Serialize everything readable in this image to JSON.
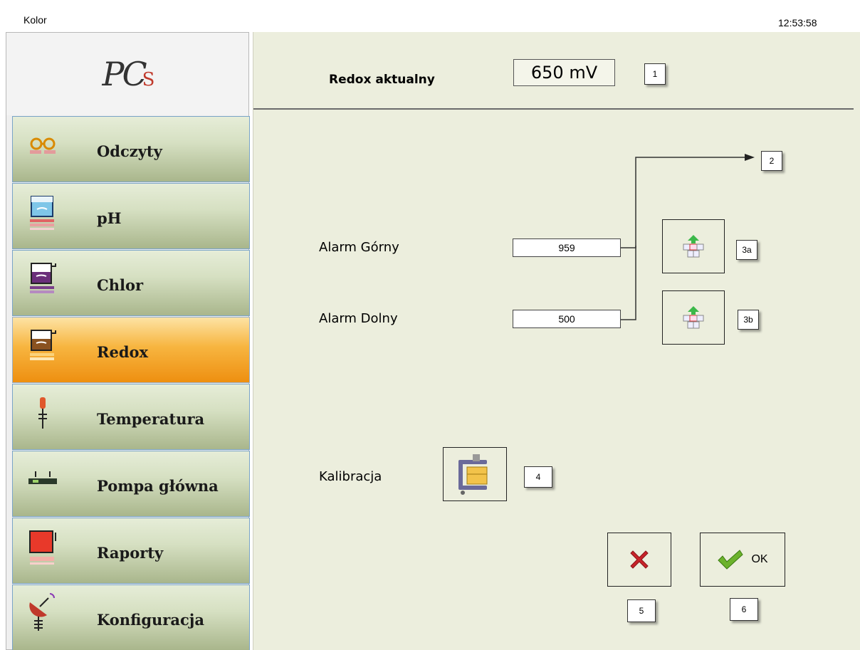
{
  "titlebar": {
    "app_title": "Kolor",
    "clock": "12:53:58"
  },
  "sidebar": {
    "logo_text": "PC",
    "logo_s": "S",
    "items": [
      {
        "label": "Odczyty",
        "icon": "glasses-icon"
      },
      {
        "label": "pH",
        "icon": "beaker-blue-icon"
      },
      {
        "label": "Chlor",
        "icon": "beaker-purple-icon"
      },
      {
        "label": "Redox",
        "icon": "beaker-orange-icon",
        "active": true
      },
      {
        "label": "Temperatura",
        "icon": "thermometer-icon"
      },
      {
        "label": "Pompa główna",
        "icon": "pump-icon"
      },
      {
        "label": "Raporty",
        "icon": "report-icon"
      },
      {
        "label": "Konfiguracja",
        "icon": "satellite-dish-icon"
      }
    ]
  },
  "main": {
    "redox_label": "Redox aktualny",
    "redox_value": "650 mV",
    "alarm_upper_label": "Alarm Górny",
    "alarm_upper_value": "959",
    "alarm_lower_label": "Alarm Dolny",
    "alarm_lower_value": "500",
    "calibration_label": "Kalibracja",
    "ok_label": "OK"
  },
  "callouts": {
    "c1": "1",
    "c2": "2",
    "c3a": "3a",
    "c3b": "3b",
    "c4": "4",
    "c5": "5",
    "c6": "6"
  },
  "colors": {
    "active_item": "#f7b540",
    "panel_bg": "#eceedd",
    "nav_bg": "#d6e0c2"
  }
}
